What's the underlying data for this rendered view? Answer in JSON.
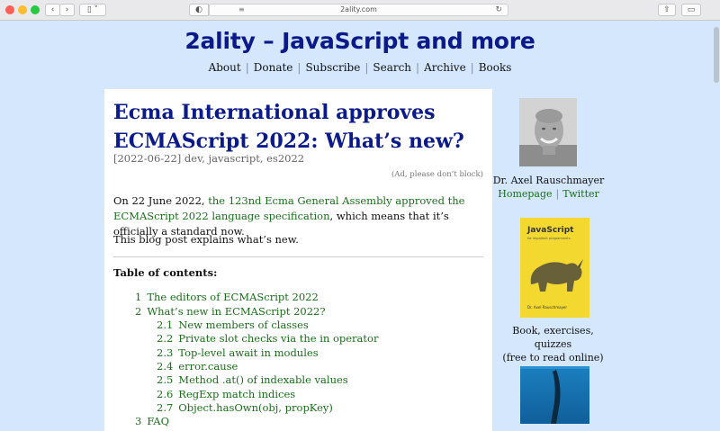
{
  "browser": {
    "url": "2ality.com",
    "back_icon": "chevron-left-icon",
    "forward_icon": "chevron-right-icon"
  },
  "header": {
    "title": "2ality – JavaScript and more",
    "nav": [
      "About",
      "Donate",
      "Subscribe",
      "Search",
      "Archive",
      "Books"
    ]
  },
  "article": {
    "title": "Ecma International approves ECMAScript 2022: What’s new?",
    "meta": "[2022-06-22] dev, javascript, es2022",
    "ad_note": "(Ad, please don’t block)",
    "p1_before": "On 22 June 2022, ",
    "p1_link": "the 123nd Ecma General Assembly approved the ECMAScript 2022 language specification",
    "p1_after": ", which means that it’s officially a standard now.",
    "p2": "This blog post explains what’s new.",
    "toc_heading": "Table of contents:",
    "toc": [
      {
        "num": "1",
        "text": "The editors of ECMAScript 2022",
        "level": 1
      },
      {
        "num": "2",
        "text": "What’s new in ECMAScript 2022?",
        "level": 1
      },
      {
        "num": "2.1",
        "text": "New members of classes",
        "level": 2
      },
      {
        "num": "2.2",
        "text": "Private slot checks via the in operator",
        "level": 2
      },
      {
        "num": "2.3",
        "text": "Top-level await in modules",
        "level": 2
      },
      {
        "num": "2.4",
        "text": "error.cause",
        "level": 2
      },
      {
        "num": "2.5",
        "text": "Method .at() of indexable values",
        "level": 2
      },
      {
        "num": "2.6",
        "text": "RegExp match indices",
        "level": 2
      },
      {
        "num": "2.7",
        "text": "Object.hasOwn(obj, propKey)",
        "level": 2
      },
      {
        "num": "3",
        "text": "FAQ",
        "level": 1
      }
    ]
  },
  "sidebar": {
    "author": "Dr. Axel Rauschmayer",
    "homepage": "Homepage",
    "twitter": "Twitter",
    "book_title": "JavaScript",
    "book_subtitle": "for impatient programmers",
    "book_author": "Dr. Axel Rauschmayer",
    "book_caption_1": "Book, exercises, quizzes",
    "book_caption_2": "(free to read online)"
  }
}
